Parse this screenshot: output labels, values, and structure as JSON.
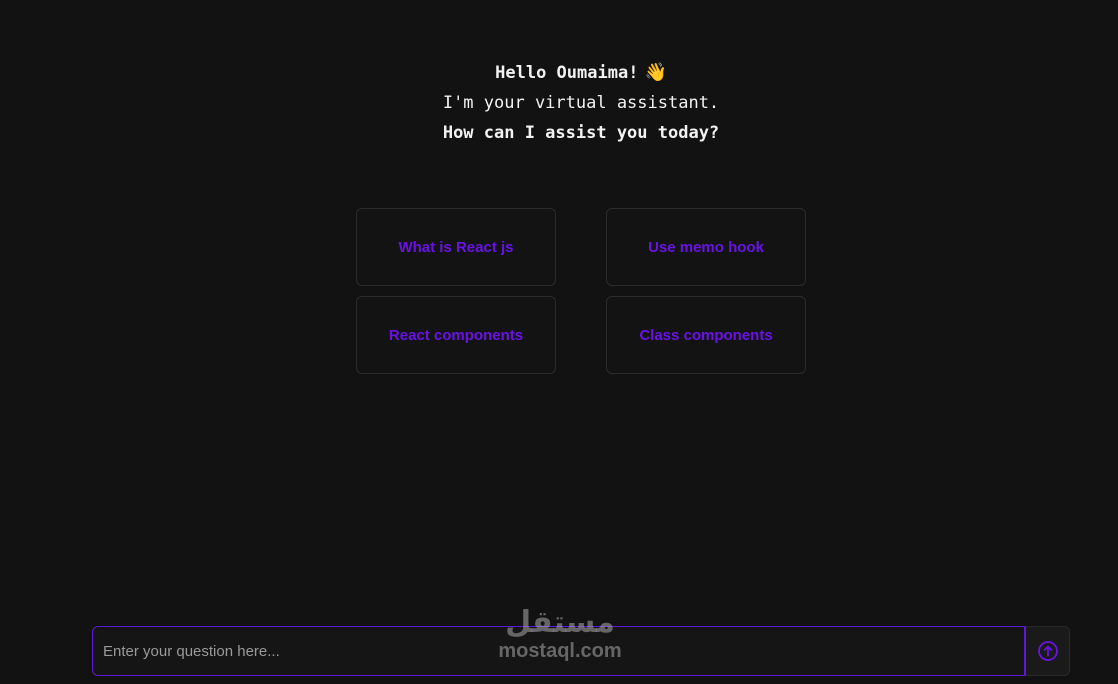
{
  "greeting": {
    "hello": "Hello Oumaima!",
    "intro": "I'm your virtual assistant.",
    "question": "How can I assist you today?",
    "icon": "waving-hand-icon"
  },
  "suggestions": [
    {
      "label": "What is React js"
    },
    {
      "label": "Use memo hook"
    },
    {
      "label": "React components"
    },
    {
      "label": "Class components"
    }
  ],
  "input": {
    "placeholder": "Enter your question here...",
    "value": "",
    "send_icon": "arrow-up-circle-icon"
  },
  "watermark": {
    "arabic": "مستقل",
    "latin": "mostaql.com"
  },
  "colors": {
    "background": "#121212",
    "accent": "#6a12e6",
    "input_border": "#5b19d6"
  }
}
